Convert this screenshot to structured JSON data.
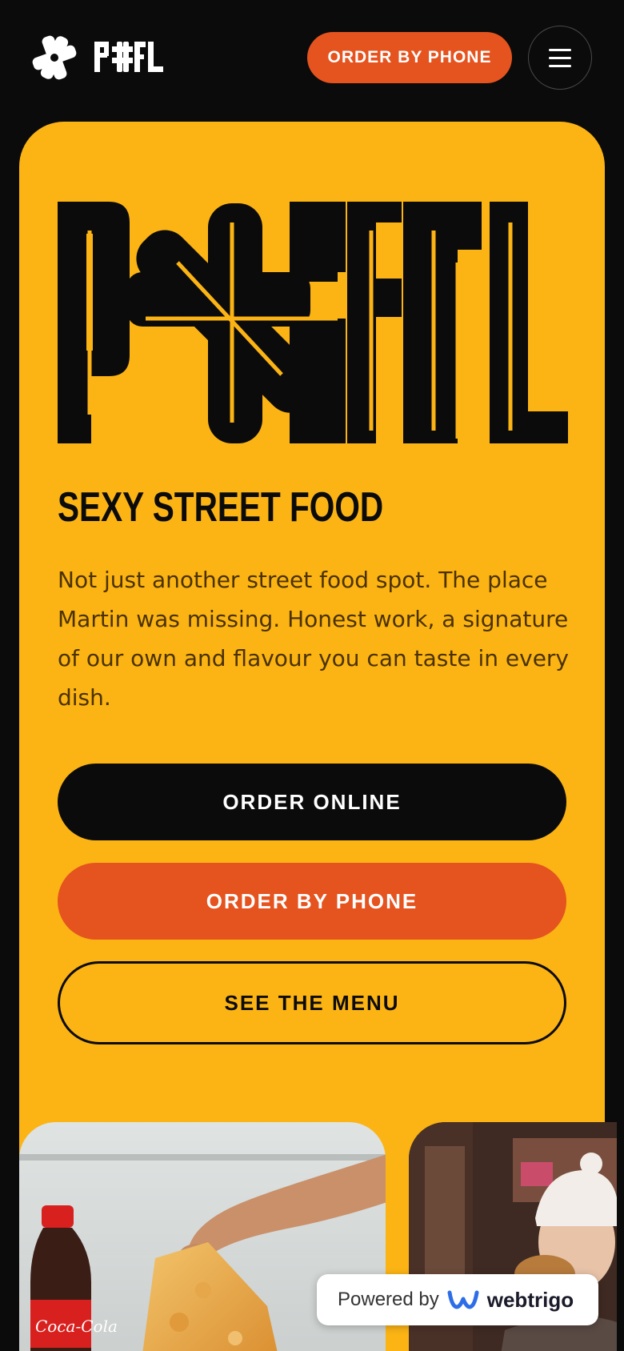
{
  "header": {
    "logo_text": "PASTEL",
    "order_phone_label": "ORDER BY PHONE",
    "menu_icon": "hamburger-icon"
  },
  "hero": {
    "logo_text": "PASTEL",
    "title": "SEXY STREET FOOD",
    "description": "Not just another street food spot. The place Martin was missing. Honest work, a signature of our own and flavour you can taste in every dish.",
    "buttons": {
      "order_online": "ORDER ONLINE",
      "order_phone": "ORDER BY PHONE",
      "see_menu": "SEE THE MENU"
    }
  },
  "photos": [
    {
      "alt": "Hand holding a slice of pizza next to a Coca-Cola bottle",
      "bottle_label": "Coca-Cola"
    },
    {
      "alt": "Woman in a white beanie biting a burger on the street"
    }
  ],
  "badge": {
    "powered_by": "Powered by",
    "brand": "webtrigo"
  },
  "colors": {
    "background": "#0b0b0b",
    "accent_yellow": "#fcb415",
    "accent_orange": "#e5531f",
    "text_dark": "#0b0b0b"
  }
}
